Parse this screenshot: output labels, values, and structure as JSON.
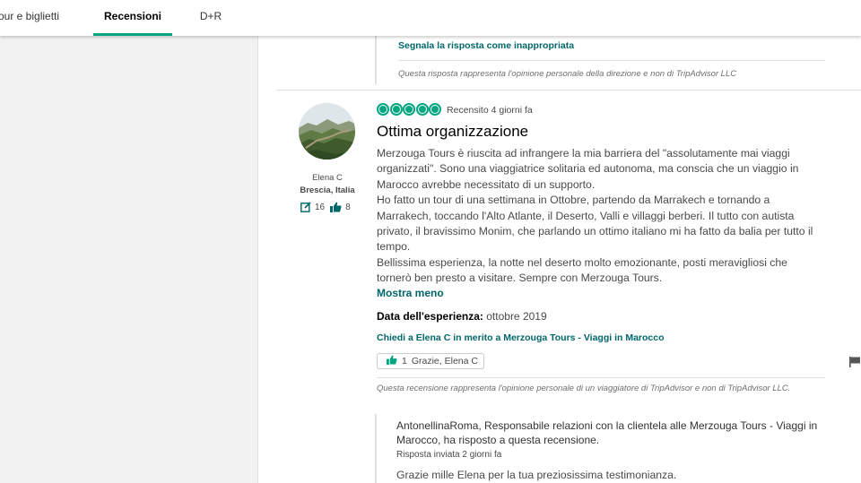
{
  "tabs": [
    {
      "label": "Tour e biglietti",
      "active": false
    },
    {
      "label": "Recensioni",
      "active": true
    },
    {
      "label": "D+R",
      "active": false
    }
  ],
  "previous_reply": {
    "report_link": "Segnala la risposta come inappropriata",
    "disclaimer": "Questa risposta rappresenta l'opinione personale della direzione e non di TripAdvisor LLC"
  },
  "review": {
    "reviewer": {
      "name": "Elena C",
      "location": "Brescia, Italia",
      "contributions": "16",
      "helpful_votes": "8"
    },
    "rating": 5,
    "review_date": "Recensito 4 giorni fa",
    "title": "Ottima organizzazione",
    "body": [
      "Merzouga Tours è riuscita ad infrangere la mia barriera del \"assolutamente mai viaggi organizzati\". Sono una viaggiatrice solitaria ed autonoma, ma conscia che un viaggio in Marocco avrebbe necessitato di un supporto.",
      "Ho fatto un tour di una settimana in Ottobre, partendo da Marrakech e tornando a Marrakech, toccando l'Alto Atlante, il Deserto, Valli e villaggi berberi. Il tutto con autista privato, il bravissimo Monim, che parlando un ottimo italiano mi ha fatto da balia per tutto il tempo.",
      "Bellissima esperienza, la notte nel deserto molto emozionante, posti meravigliosi che tornerò ben presto a visitare. Sempre con Merzouga Tours."
    ],
    "show_less": "Mostra meno",
    "experience_label": "Data dell'esperienza:",
    "experience_value": "ottobre 2019",
    "ask_link": "Chiedi a Elena C in merito a Merzouga Tours - Viaggi in Marocco",
    "thanks_count": "1",
    "thanks_label": "Grazie, Elena C",
    "disclaimer": "Questa recensione rappresenta l'opinione personale di un viaggiatore di TripAdvisor e non di TripAdvisor LLC."
  },
  "reply": {
    "header": "AntonellinaRoma, Responsabile relazioni con la clientela alle Merzouga Tours - Viaggi in Marocco, ha risposto a questa recensione.",
    "date": "Risposta inviata 2 giorni fa",
    "text": "Grazie mille Elena per la tua preziosissima testimonianza."
  },
  "colors": {
    "accent": "#00a680",
    "link": "#00666a"
  }
}
